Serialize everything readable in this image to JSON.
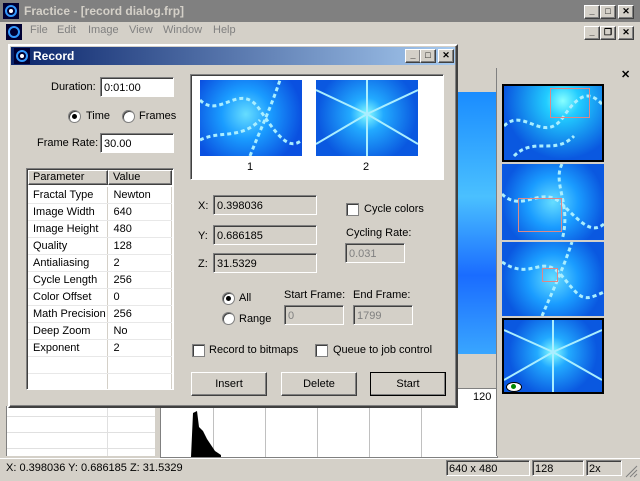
{
  "app": {
    "title": "Fractice - [record dialog.frp]",
    "menu": [
      "File",
      "Edit",
      "Image",
      "View",
      "Window",
      "Help"
    ]
  },
  "dialog": {
    "title": "Record",
    "duration_label": "Duration:",
    "duration_value": "0:01:00",
    "radio_time": "Time",
    "radio_frames": "Frames",
    "frame_rate_label": "Frame Rate:",
    "frame_rate_value": "30.00",
    "table_headers": [
      "Parameter",
      "Value"
    ],
    "params": [
      {
        "name": "Fractal Type",
        "value": "Newton"
      },
      {
        "name": "Image Width",
        "value": "640"
      },
      {
        "name": "Image Height",
        "value": "480"
      },
      {
        "name": "Quality",
        "value": "128"
      },
      {
        "name": "Antialiasing",
        "value": "2"
      },
      {
        "name": "Cycle Length",
        "value": "256"
      },
      {
        "name": "Color Offset",
        "value": "0"
      },
      {
        "name": "Math Precision",
        "value": "256"
      },
      {
        "name": "Deep Zoom",
        "value": "No"
      },
      {
        "name": "Exponent",
        "value": "2"
      }
    ],
    "keyframe_labels": [
      "1",
      "2"
    ],
    "x_label": "X:",
    "x_value": "0.398036",
    "y_label": "Y:",
    "y_value": "0.686185",
    "z_label": "Z:",
    "z_value": "31.5329",
    "cycle_colors_label": "Cycle colors",
    "cycling_rate_label": "Cycling Rate:",
    "cycling_rate_value": "0.031",
    "radio_all": "All",
    "radio_range": "Range",
    "start_frame_label": "Start Frame:",
    "start_frame_value": "0",
    "end_frame_label": "End Frame:",
    "end_frame_value": "1799",
    "record_bitmaps_label": "Record to bitmaps",
    "queue_label": "Queue to job control",
    "insert_button": "Insert",
    "delete_button": "Delete",
    "start_button": "Start"
  },
  "background": {
    "histogram_tick": "120"
  },
  "status": {
    "coords": "X: 0.398036  Y: 0.686185  Z: 31.5329",
    "size": "640 x 480",
    "quality": "128",
    "zoom": "2x"
  }
}
